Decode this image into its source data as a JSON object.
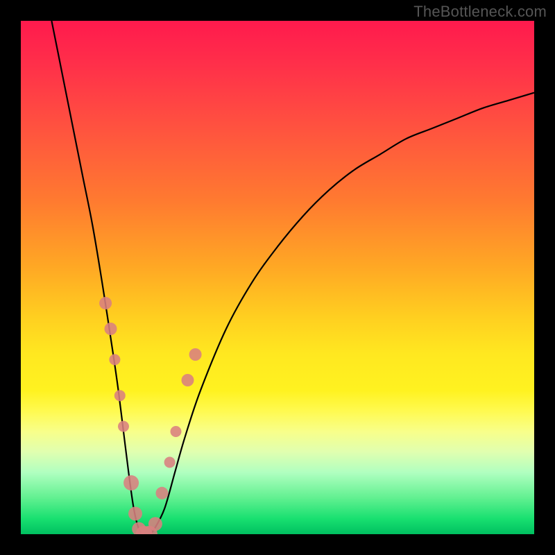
{
  "watermark": "TheBottleneck.com",
  "chart_data": {
    "type": "line",
    "title": "",
    "xlabel": "",
    "ylabel": "",
    "xlim": [
      0,
      100
    ],
    "ylim": [
      0,
      100
    ],
    "series": [
      {
        "name": "bottleneck-curve",
        "x": [
          6,
          8,
          10,
          12,
          14,
          16,
          18,
          19,
          20,
          21,
          22,
          23,
          24,
          25,
          26,
          28,
          30,
          32,
          35,
          40,
          45,
          50,
          55,
          60,
          65,
          70,
          75,
          80,
          85,
          90,
          95,
          100
        ],
        "y": [
          100,
          90,
          80,
          70,
          60,
          48,
          35,
          28,
          20,
          12,
          5,
          1,
          0,
          0,
          1,
          5,
          12,
          19,
          28,
          40,
          49,
          56,
          62,
          67,
          71,
          74,
          77,
          79,
          81,
          83,
          84.5,
          86
        ]
      }
    ],
    "markers": {
      "name": "highlight-dots",
      "x": [
        16.5,
        17.5,
        18.3,
        19.3,
        20.0,
        21.5,
        22.3,
        23.0,
        24.0,
        25.0,
        26.2,
        27.5,
        29.0,
        30.2,
        32.5,
        34.0
      ],
      "y": [
        45,
        40,
        34,
        27,
        21,
        10,
        4,
        1,
        0,
        0,
        2,
        8,
        14,
        20,
        30,
        35
      ],
      "r": [
        9,
        9,
        8,
        8,
        8,
        11,
        10,
        10,
        12,
        12,
        10,
        9,
        8,
        8,
        9,
        9
      ]
    },
    "background_gradient": {
      "top": "#ff1a4d",
      "mid": "#ffe820",
      "bottom": "#00c060"
    }
  }
}
